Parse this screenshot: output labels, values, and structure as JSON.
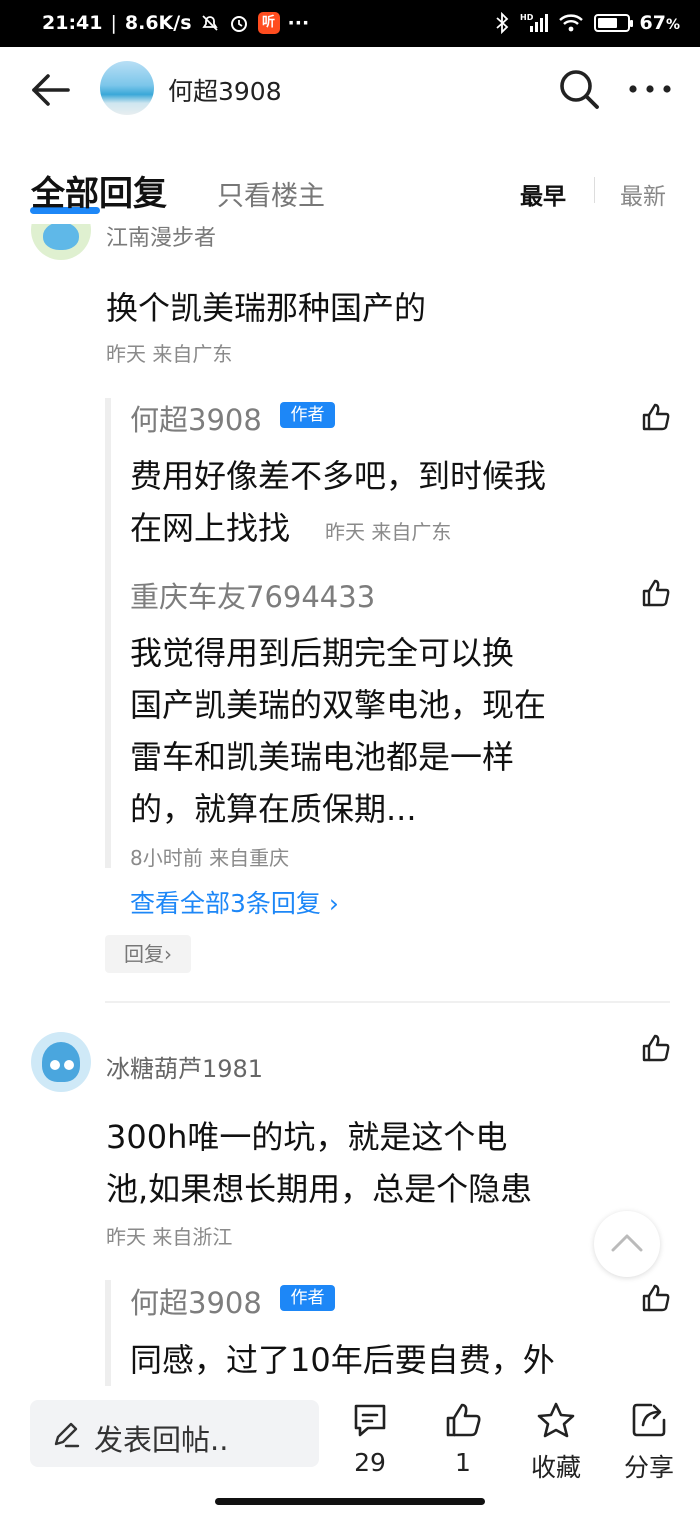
{
  "status_bar": {
    "time": "21:41",
    "net_speed": "8.6K/s",
    "app_badge": "听",
    "dots": "···",
    "signal": "HD",
    "battery_percent": "67",
    "battery_level": 0.67
  },
  "header": {
    "title": "何超3908"
  },
  "tabs": {
    "all_replies": "全部回复",
    "op_only": "只看楼主",
    "sort_earliest": "最早",
    "sort_latest": "最新"
  },
  "comments": [
    {
      "author": "江南漫步者",
      "text": "换个凯美瑞那种国产的",
      "meta": "昨天 来自广东",
      "replies": [
        {
          "author": "何超3908",
          "badge": "作者",
          "text_line1": "费用好像差不多吧，到时候我",
          "text_line2": "在网上找找",
          "meta": "昨天 来自广东"
        },
        {
          "author": "重庆车友7694433",
          "text_lines": [
            "我觉得用到后期完全可以换",
            "国产凯美瑞的双擎电池，现在",
            "雷车和凯美瑞电池都是一样",
            "的，就算在质保期..."
          ],
          "meta": "8小时前 来自重庆"
        }
      ],
      "view_all": "查看全部3条回复 ›",
      "reply_button": "回复›"
    },
    {
      "author": "冰糖葫芦1981",
      "text_lines": [
        "300h唯一的坑，就是这个电",
        "池,如果想长期用，总是个隐患"
      ],
      "meta": "昨天 来自浙江",
      "replies": [
        {
          "author": "何超3908",
          "badge": "作者",
          "text": "同感，过了10年后要自费，外"
        }
      ]
    }
  ],
  "bottom_bar": {
    "placeholder": "发表回帖..",
    "comment_count": "29",
    "like_count": "1",
    "favorite_label": "收藏",
    "share_label": "分享"
  }
}
